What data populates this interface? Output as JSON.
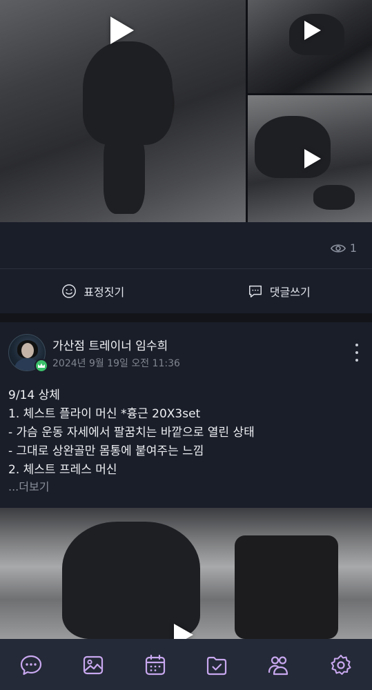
{
  "feed": {
    "view_count": "1",
    "actions": {
      "react_label": "표정짓기",
      "comment_label": "댓글쓰기"
    }
  },
  "post": {
    "author": "가산점 트레이너 임수희",
    "timestamp": "2024년 9월 19일 오전 11:36",
    "body_lines": [
      "9/14 상체",
      "1. 체스트 플라이 머신 *흉근 20X3set",
      "- 가슴 운동 자세에서 팔꿈치는 바깥으로 열린 상태",
      "- 그대로 상완골만 몸통에 붙여주는 느낌",
      "2. 체스트 프레스 머신"
    ],
    "read_more": "...더보기"
  },
  "colors": {
    "background": "#1a1e29",
    "nav_background": "#242a37",
    "badge_green": "#3bbf6a",
    "muted_text": "#80868f"
  },
  "nav": {
    "icons": [
      "chat-icon",
      "image-icon",
      "calendar-icon",
      "folder-check-icon",
      "people-icon",
      "settings-icon"
    ]
  }
}
